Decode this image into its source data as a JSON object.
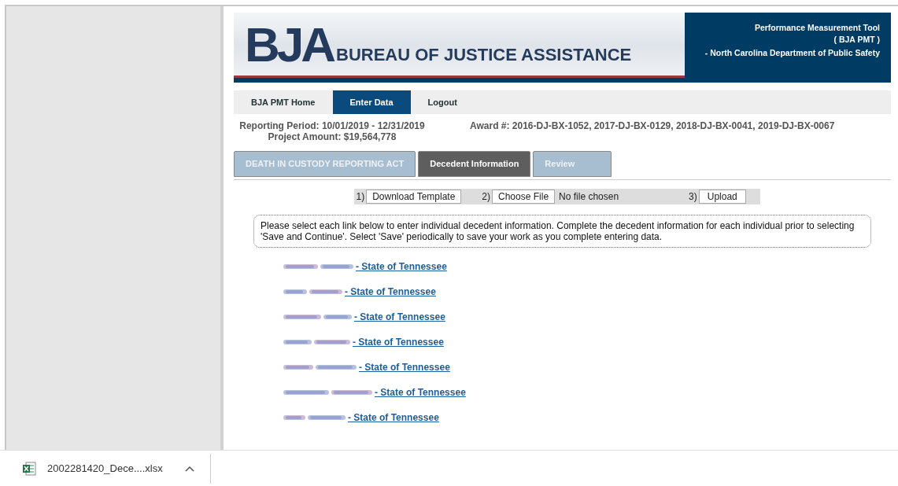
{
  "banner": {
    "logo": "BJA",
    "agency": "BUREAU OF JUSTICE ASSISTANCE",
    "tool_lines": [
      "Performance Measurement Tool",
      "( BJA PMT )",
      "- North Carolina Department of Public Safety"
    ]
  },
  "nav": [
    {
      "label": "BJA PMT Home",
      "selected": false
    },
    {
      "label": "Enter Data",
      "selected": true
    },
    {
      "label": "Logout",
      "selected": false
    }
  ],
  "reporting_period": "Reporting Period: 10/01/2019 - 12/31/2019",
  "project_amount": "Project Amount: $19,564,778",
  "award": "Award #: 2016-DJ-BX-1052, 2017-DJ-BX-0129, 2018-DJ-BX-0041, 2019-DJ-BX-0067",
  "tabs": [
    {
      "label": "DEATH IN CUSTODY REPORTING ACT",
      "selected": false
    },
    {
      "label": "Decedent Information",
      "selected": true
    },
    {
      "label": "Review",
      "selected": false
    }
  ],
  "upload_bar": {
    "steps": [
      "1)",
      "2)",
      "3)"
    ],
    "download_button": "Download Template",
    "choose_button": "Choose File",
    "file_status": "No file chosen",
    "upload_button": "Upload"
  },
  "instructions": "Please select each link below to enter individual decedent information. Complete the decedent information for each individual prior to selecting 'Save and Continue'. Select 'Save' periodically to save your work as you complete entering data.",
  "decedents": [
    {
      "suffix": "- State of Tennessee"
    },
    {
      "suffix": "- State of Tennessee"
    },
    {
      "suffix": "- State of Tennessee"
    },
    {
      "suffix": "- State of Tennessee"
    },
    {
      "suffix": "- State of Tennessee"
    },
    {
      "suffix": "- State of Tennessee"
    },
    {
      "suffix": "- State of Tennessee"
    }
  ],
  "download_shelf": {
    "filename": "2002281420_Dece....xlsx"
  }
}
